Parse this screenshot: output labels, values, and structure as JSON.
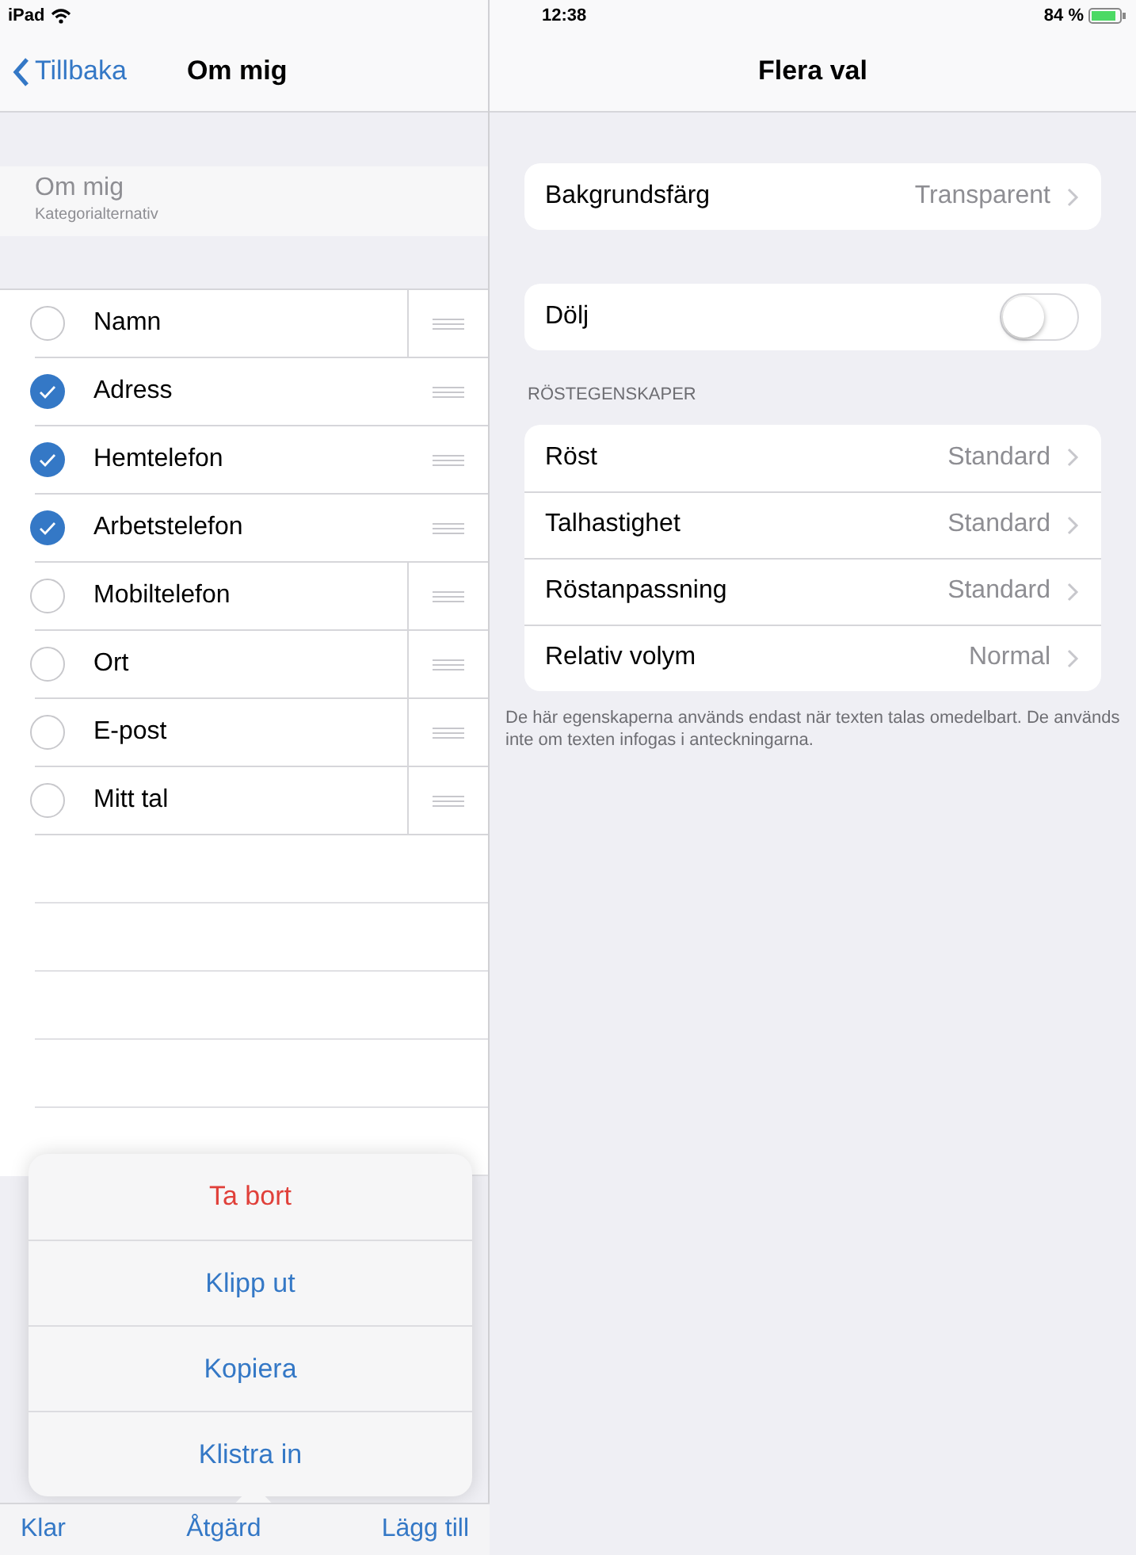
{
  "status_bar": {
    "device": "iPad",
    "time": "12:38",
    "battery": "84 %"
  },
  "left": {
    "back": "Tillbaka",
    "title": "Om mig",
    "header": {
      "title": "Om mig",
      "subtitle": "Kategorialternativ"
    },
    "items": [
      {
        "label": "Namn",
        "checked": false
      },
      {
        "label": "Adress",
        "checked": true
      },
      {
        "label": "Hemtelefon",
        "checked": true
      },
      {
        "label": "Arbetstelefon",
        "checked": true
      },
      {
        "label": "Mobiltelefon",
        "checked": false
      },
      {
        "label": "Ort",
        "checked": false
      },
      {
        "label": "E-post",
        "checked": false
      },
      {
        "label": "Mitt tal",
        "checked": false
      }
    ],
    "menu": [
      {
        "label": "Ta bort",
        "kind": "destructive"
      },
      {
        "label": "Klipp ut",
        "kind": "normal"
      },
      {
        "label": "Kopiera",
        "kind": "normal"
      },
      {
        "label": "Klistra in",
        "kind": "normal"
      }
    ],
    "toolbar": [
      "Klar",
      "Åtgärd",
      "Lägg till"
    ]
  },
  "right": {
    "title": "Flera val",
    "groups": [
      {
        "rows": [
          {
            "kind": "disclosure",
            "label": "Bakgrundsfärg",
            "value": "Transparent"
          }
        ]
      },
      {
        "rows": [
          {
            "kind": "toggle",
            "label": "Dölj",
            "on": false
          }
        ]
      },
      {
        "header": "RÖSTEGENSKAPER",
        "rows": [
          {
            "kind": "disclosure",
            "label": "Röst",
            "value": "Standard"
          },
          {
            "kind": "disclosure",
            "label": "Talhastighet",
            "value": "Standard"
          },
          {
            "kind": "disclosure",
            "label": "Röstanpassning",
            "value": "Standard"
          },
          {
            "kind": "disclosure",
            "label": "Relativ volym",
            "value": "Normal"
          }
        ],
        "footer": "De här egenskaperna används endast när texten talas omedelbart. De används inte om texten infogas i anteckningarna."
      }
    ]
  }
}
